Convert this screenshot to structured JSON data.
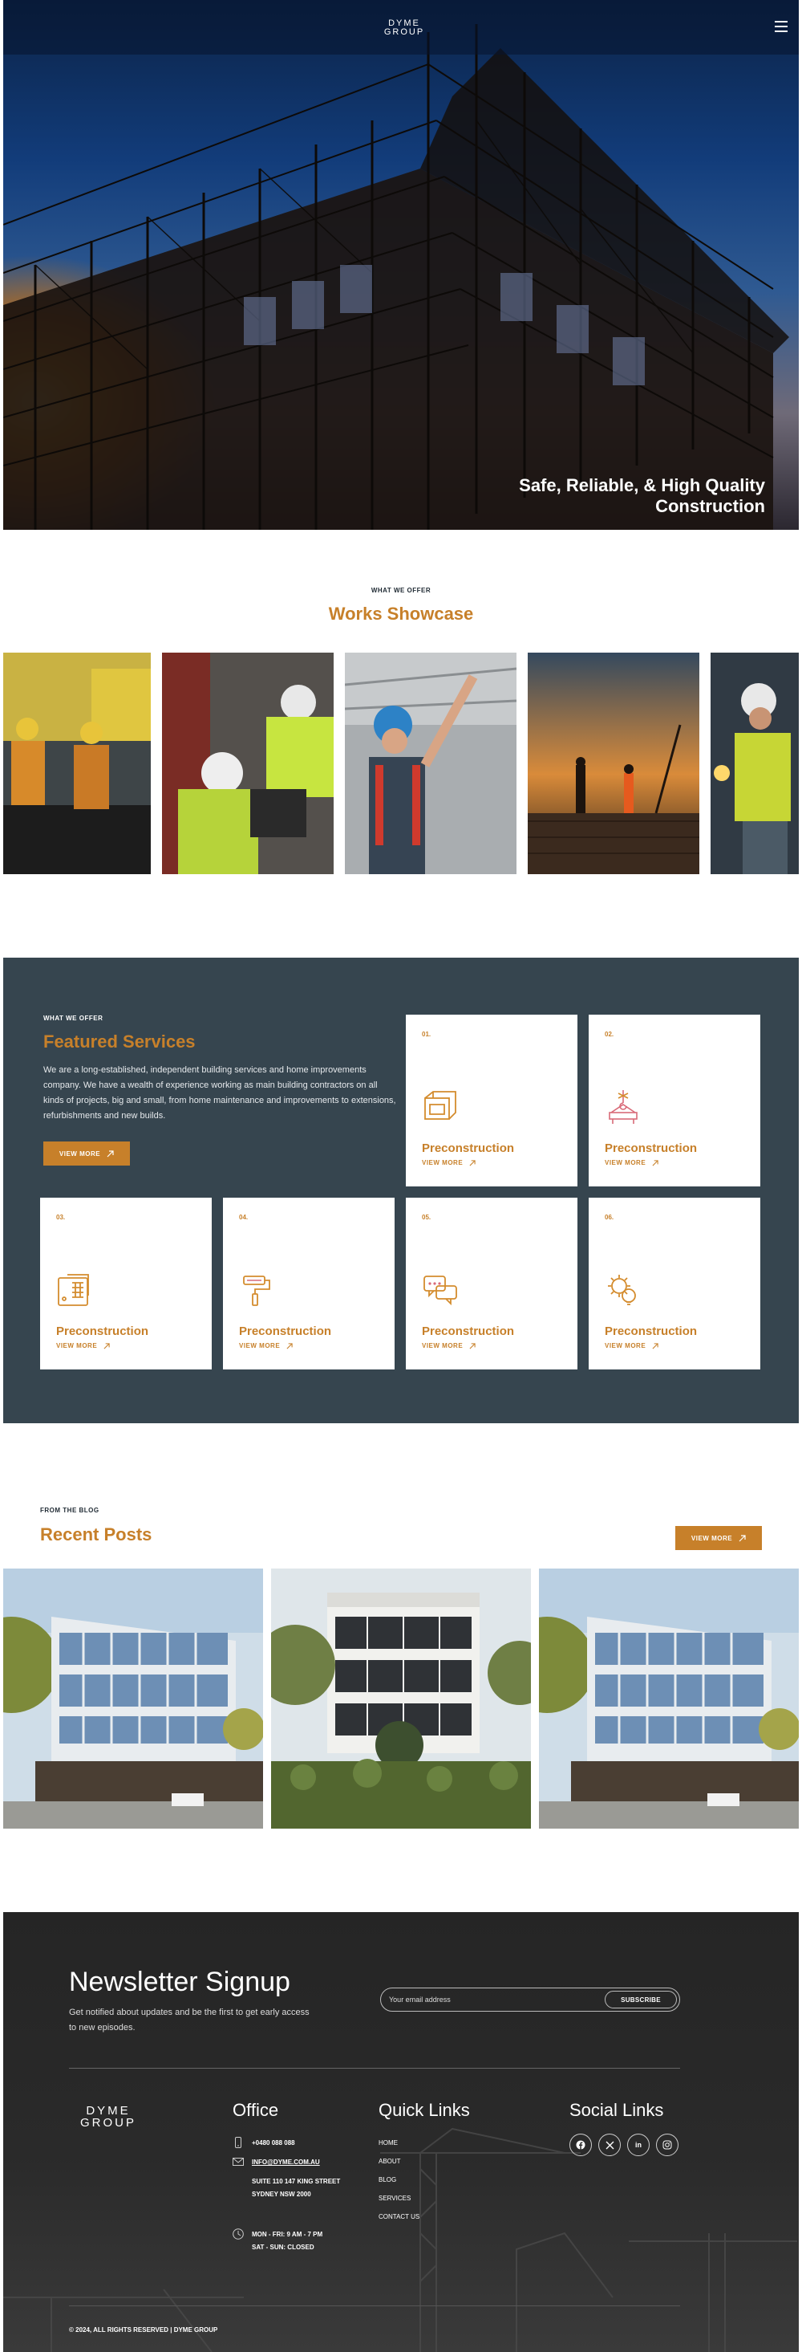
{
  "header": {
    "logo_line1": "DYME",
    "logo_line2": "GROUP",
    "menu_icon": "hamburger-menu-icon"
  },
  "hero": {
    "title": "Safe, Reliable, & High Quality Construction"
  },
  "works": {
    "eyebrow": "WHAT WE OFFER",
    "title": "Works Showcase"
  },
  "services": {
    "eyebrow": "WHAT WE OFFER",
    "title": "Featured Services",
    "description": "We are a long-established, independent building services and home improvements company. We have a wealth of experience working as main building contractors on all kinds of projects, big and small, from home maintenance and improvements to extensions, refurbishments and new builds.",
    "button_label": "VIEW MORE",
    "cards": [
      {
        "num": "01.",
        "name": "Preconstruction",
        "link": "VIEW MORE",
        "icon": "blueprint-icon"
      },
      {
        "num": "02.",
        "name": "Preconstruction",
        "link": "VIEW MORE",
        "icon": "crane-hook-icon"
      },
      {
        "num": "03.",
        "name": "Preconstruction",
        "link": "VIEW MORE",
        "icon": "brick-wall-icon"
      },
      {
        "num": "04.",
        "name": "Preconstruction",
        "link": "VIEW MORE",
        "icon": "paint-roller-icon"
      },
      {
        "num": "05.",
        "name": "Preconstruction",
        "link": "VIEW MORE",
        "icon": "chat-bubbles-icon"
      },
      {
        "num": "06.",
        "name": "Preconstruction",
        "link": "VIEW MORE",
        "icon": "gear-bulb-icon"
      }
    ]
  },
  "blog": {
    "eyebrow": "FROM THE BLOG",
    "title": "Recent Posts",
    "button_label": "VIEW MORE"
  },
  "newsletter": {
    "title": "Newsletter Signup",
    "subtitle": "Get notified about updates and be the first to get early access to new episodes.",
    "email_placeholder": "Your email address",
    "subscribe_label": "SUBSCRIBE"
  },
  "footer": {
    "logo_line1": "DYME",
    "logo_line2": "GROUP",
    "office_title": "Office",
    "phone": "+0480 088 088",
    "email": "INFO@DYME.COM.AU",
    "address_line1": "SUITE 110 147 KING STREET",
    "address_line2": "SYDNEY NSW 2000",
    "hours_line1": "MON - FRI: 9 AM - 7 PM",
    "hours_line2": "SAT - SUN: CLOSED",
    "quick_links_title": "Quick Links",
    "quick_links": [
      "HOME",
      "ABOUT",
      "BLOG",
      "SERVICES",
      "CONTACT US"
    ],
    "social_title": "Social Links",
    "social_icons": [
      "facebook-icon",
      "x-icon",
      "linkedin-icon",
      "instagram-icon"
    ],
    "copyright": "© 2024, ALL RIGHTS RESERVED | DYME GROUP"
  },
  "colors": {
    "accent": "#c7802a",
    "services_bg": "#36454f",
    "footer_bg": "#262626"
  }
}
